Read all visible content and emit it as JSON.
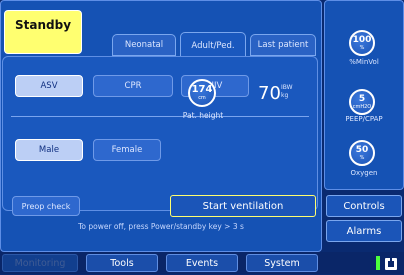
{
  "standby_label": "Standby",
  "tabs": {
    "neonatal": "Neonatal",
    "adult": "Adult/Ped.",
    "last_patient": "Last patient"
  },
  "modes": {
    "asv": "ASV",
    "cpr": "CPR",
    "niv": "NIV"
  },
  "gender": {
    "male": "Male",
    "female": "Female"
  },
  "patient": {
    "height_value": "174",
    "height_unit": "cm",
    "height_label": "Pat. height",
    "ibw_value": "70",
    "ibw_unit_top": "IBW",
    "ibw_unit_bottom": "kg"
  },
  "preop_label": "Preop check",
  "start_ventilation_label": "Start ventilation",
  "power_message": "To power off, press Power/standby key > 3 s",
  "settings": {
    "minvol": {
      "value": "100",
      "unit": "%",
      "label": "%MinVol"
    },
    "peep": {
      "value": "5",
      "unit": "cmH2O",
      "label": "PEEP/CPAP"
    },
    "oxygen": {
      "value": "50",
      "unit": "%",
      "label": "Oxygen"
    }
  },
  "controls_label": "Controls",
  "alarms_label": "Alarms",
  "bottom_nav": {
    "monitoring": "Monitoring",
    "tools": "Tools",
    "events": "Events",
    "system": "System"
  },
  "colors": {
    "standby_bg": "#ffff70",
    "panel_bg": "#1552b4",
    "selected_btn": "#bccff5",
    "status_green": "#4cff3c"
  }
}
